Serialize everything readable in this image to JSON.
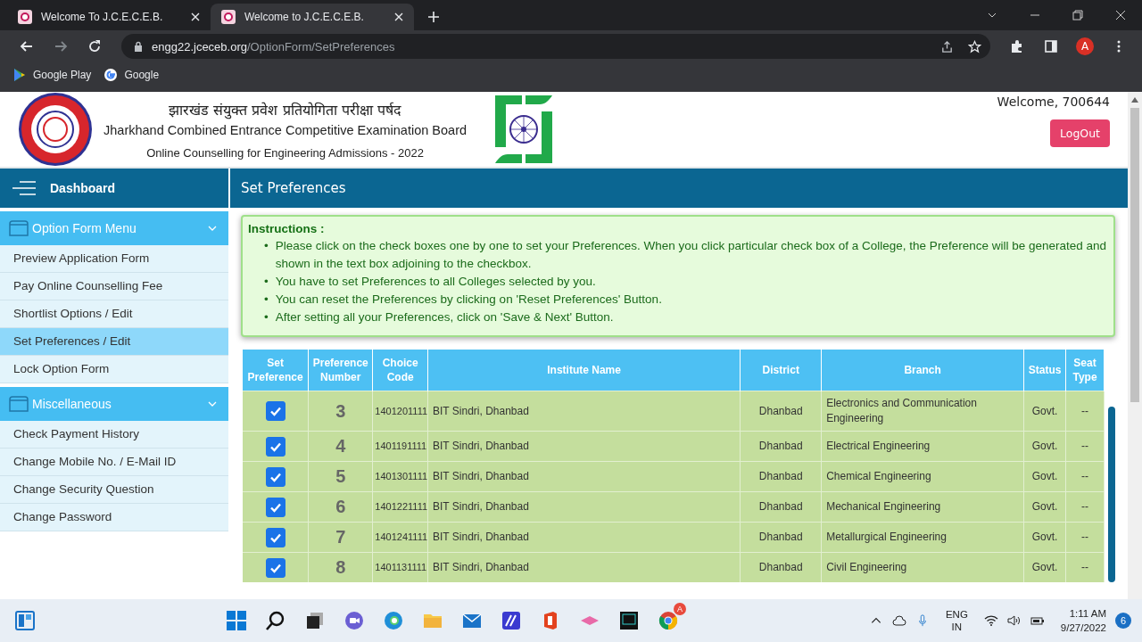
{
  "browser": {
    "tabs": [
      {
        "title": "Welcome To J.C.E.C.E.B.",
        "selected": false
      },
      {
        "title": "Welcome to J.C.E.C.E.B.",
        "selected": true
      }
    ],
    "url": {
      "host": "engg22.jceceb.org",
      "path": "/OptionForm/SetPreferences"
    },
    "profile_initial": "A",
    "bookmarks": [
      "Google Play",
      "Google"
    ]
  },
  "header": {
    "hindi_title": "झारखंड संयुक्त प्रवेश प्रतियोगिता परीक्षा पर्षद",
    "english_title": "Jharkhand Combined Entrance Competitive Examination Board",
    "subtitle": "Online Counselling for Engineering Admissions - 2022",
    "welcome": "Welcome, 700644",
    "logout": "LogOut"
  },
  "sidebar": {
    "dashboard": "Dashboard",
    "sections": [
      {
        "title": "Option Form Menu",
        "expanded": true,
        "items": [
          {
            "label": "Preview Application Form",
            "selected": false
          },
          {
            "label": "Pay Online Counselling Fee",
            "selected": false
          },
          {
            "label": "Shortlist Options / Edit",
            "selected": false
          },
          {
            "label": "Set Preferences / Edit",
            "selected": true
          },
          {
            "label": "Lock Option Form",
            "selected": false
          }
        ]
      },
      {
        "title": "Miscellaneous",
        "expanded": true,
        "items": [
          {
            "label": "Check Payment History",
            "selected": false
          },
          {
            "label": "Change Mobile No. / E-Mail ID",
            "selected": false
          },
          {
            "label": "Change Security Question",
            "selected": false
          },
          {
            "label": "Change Password",
            "selected": false
          }
        ]
      }
    ]
  },
  "main": {
    "title": "Set Preferences",
    "instructions": {
      "heading": "Instructions :",
      "bullet": "•",
      "items": [
        "Please click on the check boxes one by one to set your Preferences. When you click particular check box of a College, the Preference will be generated and shown in the text box adjoining to the checkbox.",
        "You have to set Preferences to all Colleges selected by you.",
        "You can reset the Preferences by clicking on 'Reset Preferences' Button.",
        "After setting all your Preferences, click on 'Save & Next' Button."
      ]
    }
  },
  "table": {
    "columns": [
      "Set Preference",
      "Preference Number",
      "Choice Code",
      "Institute Name",
      "District",
      "Branch",
      "Status",
      "Seat Type"
    ],
    "rows": [
      {
        "checked": true,
        "preference": "3",
        "code": "1401201111",
        "institute": "BIT Sindri, Dhanbad",
        "district": "Dhanbad",
        "branch": "Electronics and Communication Engineering",
        "status": "Govt.",
        "seat_type": "--"
      },
      {
        "checked": true,
        "preference": "4",
        "code": "1401191111",
        "institute": "BIT Sindri, Dhanbad",
        "district": "Dhanbad",
        "branch": "Electrical Engineering",
        "status": "Govt.",
        "seat_type": "--"
      },
      {
        "checked": true,
        "preference": "5",
        "code": "1401301111",
        "institute": "BIT Sindri, Dhanbad",
        "district": "Dhanbad",
        "branch": "Chemical Engineering",
        "status": "Govt.",
        "seat_type": "--"
      },
      {
        "checked": true,
        "preference": "6",
        "code": "1401221111",
        "institute": "BIT Sindri, Dhanbad",
        "district": "Dhanbad",
        "branch": "Mechanical Engineering",
        "status": "Govt.",
        "seat_type": "--"
      },
      {
        "checked": true,
        "preference": "7",
        "code": "1401241111",
        "institute": "BIT Sindri, Dhanbad",
        "district": "Dhanbad",
        "branch": "Metallurgical Engineering",
        "status": "Govt.",
        "seat_type": "--"
      },
      {
        "checked": true,
        "preference": "8",
        "code": "1401131111",
        "institute": "BIT Sindri, Dhanbad",
        "district": "Dhanbad",
        "branch": "Civil Engineering",
        "status": "Govt.",
        "seat_type": "--"
      }
    ]
  },
  "taskbar": {
    "language": [
      "ENG",
      "IN"
    ],
    "time": "1:11 AM",
    "date": "9/27/2022",
    "notification_count": "6",
    "browser_badge": "A"
  }
}
